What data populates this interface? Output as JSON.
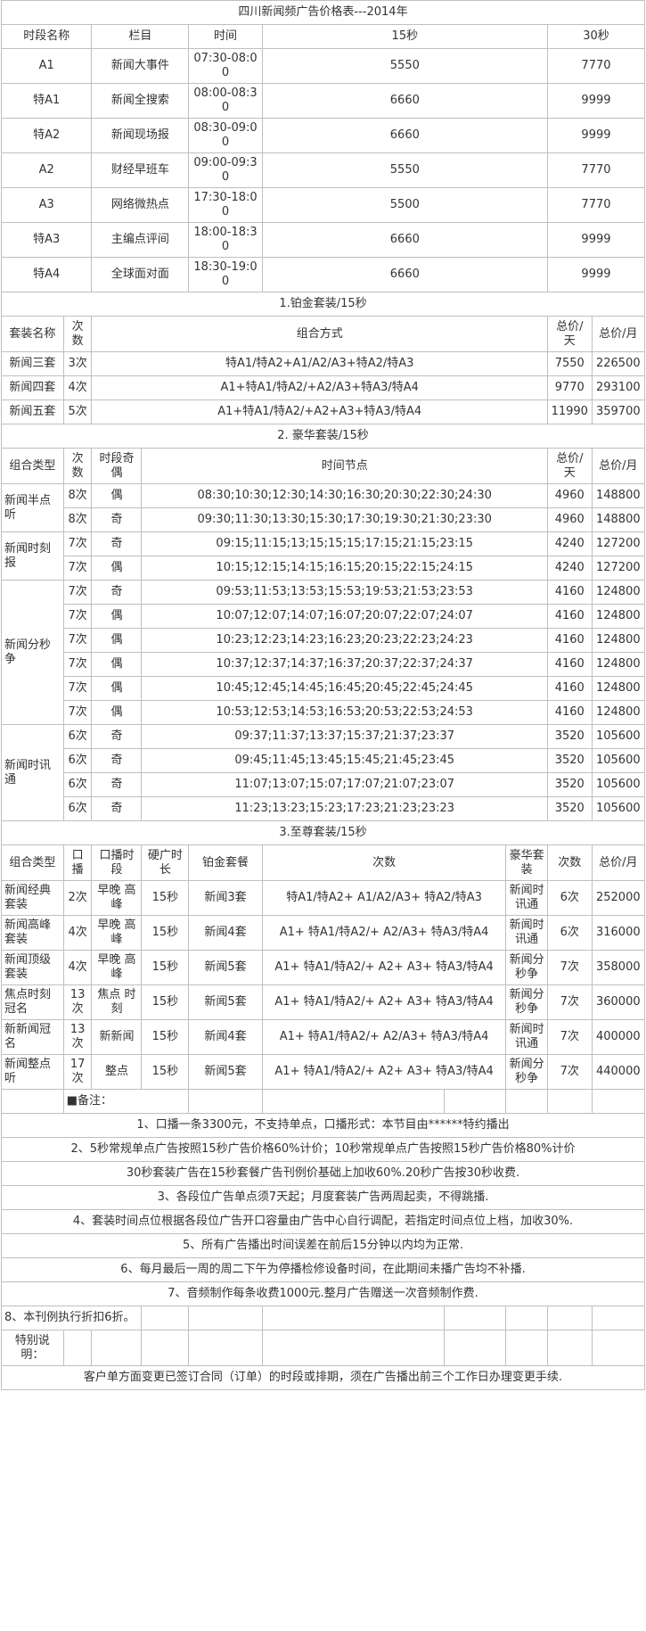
{
  "title": "四川新闻频广告价格表---2014年",
  "rate": {
    "headers": [
      "时段名称",
      "栏目",
      "时间",
      "15秒",
      "30秒"
    ],
    "rows": [
      {
        "slot": "A1",
        "program": "新闻大事件",
        "time": "07:30-08:00",
        "p15": "5550",
        "p30": "7770"
      },
      {
        "slot": "特A1",
        "program": "新闻全搜索",
        "time": "08:00-08:30",
        "p15": "6660",
        "p30": "9999"
      },
      {
        "slot": "特A2",
        "program": "新闻现场报",
        "time": "08:30-09:00",
        "p15": "6660",
        "p30": "9999"
      },
      {
        "slot": "A2",
        "program": "财经早班车",
        "time": "09:00-09:30",
        "p15": "5550",
        "p30": "7770"
      },
      {
        "slot": "A3",
        "program": "网络微热点",
        "time": "17:30-18:00",
        "p15": "5500",
        "p30": "7770"
      },
      {
        "slot": "特A3",
        "program": "主编点评间",
        "time": "18:00-18:30",
        "p15": "6660",
        "p30": "9999"
      },
      {
        "slot": "特A4",
        "program": "全球面对面",
        "time": "18:30-19:00",
        "p15": "6660",
        "p30": "9999"
      }
    ]
  },
  "platinum": {
    "title": "1.铂金套装/15秒",
    "headers": [
      "套装名称",
      "次数",
      "组合方式",
      "总价/天",
      "总价/月"
    ],
    "rows": [
      {
        "name": "新闻三套",
        "times": "3次",
        "combo": "特A1/特A2+A1/A2/A3+特A2/特A3",
        "day": "7550",
        "month": "226500"
      },
      {
        "name": "新闻四套",
        "times": "4次",
        "combo": "A1+特A1/特A2/+A2/A3+特A3/特A4",
        "day": "9770",
        "month": "293100"
      },
      {
        "name": "新闻五套",
        "times": "5次",
        "combo": "A1+特A1/特A2/+A2+A3+特A3/特A4",
        "day": "11990",
        "month": "359700"
      }
    ]
  },
  "luxury": {
    "title": "2. 豪华套装/15秒",
    "headers": [
      "组合类型",
      "次数",
      "时段奇偶",
      "时间节点",
      "总价/天",
      "总价/月"
    ],
    "groups": [
      {
        "name": "新闻半点听",
        "rows": [
          {
            "times": "8次",
            "parity": "偶",
            "nodes": "08:30;10:30;12:30;14:30;16:30;20:30;22:30;24:30",
            "day": "4960",
            "month": "148800"
          },
          {
            "times": "8次",
            "parity": "奇",
            "nodes": "09:30;11:30;13:30;15:30;17:30;19:30;21:30;23:30",
            "day": "4960",
            "month": "148800"
          }
        ]
      },
      {
        "name": "新闻时刻报",
        "rows": [
          {
            "times": "7次",
            "parity": "奇",
            "nodes": "09:15;11:15;13;15;15;15;17:15;21:15;23:15",
            "day": "4240",
            "month": "127200"
          },
          {
            "times": "7次",
            "parity": "偶",
            "nodes": "10:15;12:15;14:15;16:15;20:15;22:15;24:15",
            "day": "4240",
            "month": "127200"
          }
        ]
      },
      {
        "name": "新闻分秒争",
        "rows": [
          {
            "times": "7次",
            "parity": "奇",
            "nodes": "09:53;11:53;13:53;15:53;19:53;21:53;23:53",
            "day": "4160",
            "month": "124800"
          },
          {
            "times": "7次",
            "parity": "偶",
            "nodes": "10:07;12:07;14:07;16:07;20:07;22:07;24:07",
            "day": "4160",
            "month": "124800"
          },
          {
            "times": "7次",
            "parity": "偶",
            "nodes": "10:23;12:23;14:23;16:23;20:23;22:23;24:23",
            "day": "4160",
            "month": "124800"
          },
          {
            "times": "7次",
            "parity": "偶",
            "nodes": "10:37;12:37;14:37;16:37;20:37;22:37;24:37",
            "day": "4160",
            "month": "124800"
          },
          {
            "times": "7次",
            "parity": "偶",
            "nodes": "10:45;12:45;14:45;16:45;20:45;22:45;24:45",
            "day": "4160",
            "month": "124800"
          },
          {
            "times": "7次",
            "parity": "偶",
            "nodes": "10:53;12:53;14:53;16:53;20:53;22:53;24:53",
            "day": "4160",
            "month": "124800"
          }
        ]
      },
      {
        "name": "新闻时讯通",
        "rows": [
          {
            "times": "6次",
            "parity": "奇",
            "nodes": "09:37;11:37;13:37;15:37;21:37;23:37",
            "day": "3520",
            "month": "105600"
          },
          {
            "times": "6次",
            "parity": "奇",
            "nodes": "09:45;11:45;13:45;15:45;21:45;23:45",
            "day": "3520",
            "month": "105600"
          },
          {
            "times": "6次",
            "parity": "奇",
            "nodes": "11:07;13:07;15:07;17:07;21:07;23:07",
            "day": "3520",
            "month": "105600"
          },
          {
            "times": "6次",
            "parity": "奇",
            "nodes": "11:23;13:23;15:23;17:23;21:23;23:23",
            "day": "3520",
            "month": "105600"
          }
        ]
      }
    ]
  },
  "supreme": {
    "title": "3.至尊套装/15秒",
    "headers": [
      "组合类型",
      "口播",
      "口播时段",
      "硬广时长",
      "铂金套餐",
      "次数",
      "豪华套装",
      "次数",
      "总价/月"
    ],
    "rows": [
      {
        "name": "新闻经典套装",
        "oral": "2次",
        "oral_slot": "早晚 高峰",
        "dur": "15秒",
        "platinum": "新闻3套",
        "times": "特A1/特A2+ A1/A2/A3+ 特A2/特A3",
        "luxury": "新闻时讯通",
        "lux_times": "6次",
        "month": "252000"
      },
      {
        "name": "新闻高峰套装",
        "oral": "4次",
        "oral_slot": "早晚 高峰",
        "dur": "15秒",
        "platinum": "新闻4套",
        "times": "A1+ 特A1/特A2/+ A2/A3+ 特A3/特A4",
        "luxury": "新闻时讯通",
        "lux_times": "6次",
        "month": "316000"
      },
      {
        "name": "新闻顶级套装",
        "oral": "4次",
        "oral_slot": "早晚 高峰",
        "dur": "15秒",
        "platinum": "新闻5套",
        "times": "A1+ 特A1/特A2/+ A2+ A3+ 特A3/特A4",
        "luxury": "新闻分秒争",
        "lux_times": "7次",
        "month": "358000"
      },
      {
        "name": "焦点时刻冠名",
        "oral": "13次",
        "oral_slot": "焦点 时刻",
        "dur": "15秒",
        "platinum": "新闻5套",
        "times": "A1+ 特A1/特A2/+ A2+ A3+ 特A3/特A4",
        "luxury": "新闻分秒争",
        "lux_times": "7次",
        "month": "360000"
      },
      {
        "name": "新新闻冠名",
        "oral": "13次",
        "oral_slot": "新新闻",
        "dur": "15秒",
        "platinum": "新闻4套",
        "times": "A1+ 特A1/特A2/+ A2/A3+ 特A3/特A4",
        "luxury": "新闻时讯通",
        "lux_times": "7次",
        "month": "400000"
      },
      {
        "name": "新闻整点听",
        "oral": "17次",
        "oral_slot": "整点",
        "dur": "15秒",
        "platinum": "新闻5套",
        "times": "A1+ 特A1/特A2/+ A2+ A3+ 特A3/特A4",
        "luxury": "新闻分秒争",
        "lux_times": "7次",
        "month": "440000"
      }
    ]
  },
  "notes": {
    "label": "■备注：",
    "items": [
      "1、口播一条3300元，不支持单点，口播形式：本节目由******特约播出",
      "2、5秒常规单点广告按照15秒广告价格60%计价；10秒常规单点广告按照15秒广告价格80%计价",
      "30秒套装广告在15秒套餐广告刊例价基础上加收60%.20秒广告按30秒收费.",
      "3、各段位广告单点须7天起；月度套装广告两周起卖，不得跳播.",
      "4、套装时间点位根据各段位广告开口容量由广告中心自行调配，若指定时间点位上档，加收30%.",
      "5、所有广告播出时间误差在前后15分钟以内均为正常.",
      "6、每月最后一周的周二下午为停播检修设备时间，在此期间未播广告均不补播.",
      "7、音频制作每条收费1000元.整月广告赠送一次音频制作费.",
      "8、本刊例执行折扣6折。"
    ],
    "special_label": "特别说明：",
    "footer": "客户单方面变更已签订合同（订单）的时段或排期，须在广告播出前三个工作日办理变更手续."
  }
}
